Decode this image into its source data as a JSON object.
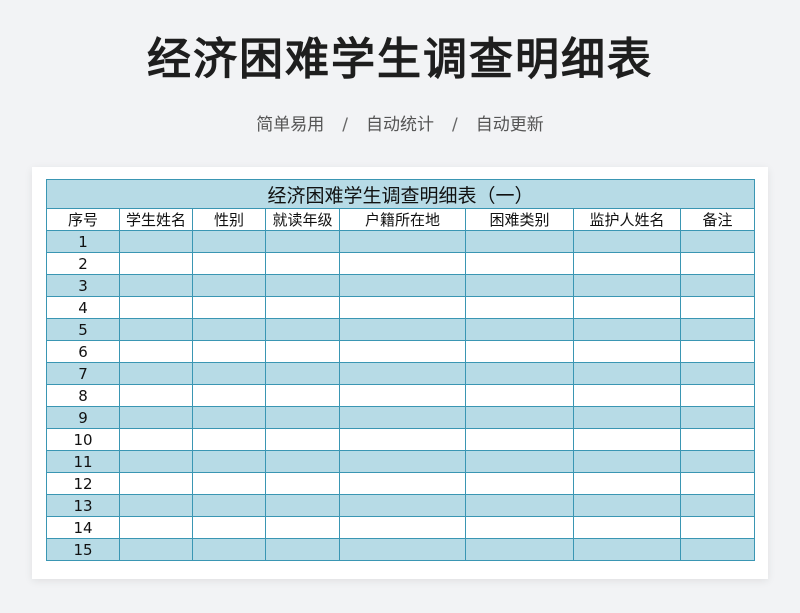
{
  "page": {
    "title": "经济困难学生调查明细表",
    "tags": [
      "简单易用",
      "自动统计",
      "自动更新"
    ],
    "separator": "/"
  },
  "table": {
    "caption": "经济困难学生调查明细表（一）",
    "columns": [
      "序号",
      "学生姓名",
      "性别",
      "就读年级",
      "户籍所在地",
      "困难类别",
      "监护人姓名",
      "备注"
    ],
    "rows": [
      {
        "no": "1"
      },
      {
        "no": "2"
      },
      {
        "no": "3"
      },
      {
        "no": "4"
      },
      {
        "no": "5"
      },
      {
        "no": "6"
      },
      {
        "no": "7"
      },
      {
        "no": "8"
      },
      {
        "no": "9"
      },
      {
        "no": "10"
      },
      {
        "no": "11"
      },
      {
        "no": "12"
      },
      {
        "no": "13"
      },
      {
        "no": "14"
      },
      {
        "no": "15"
      }
    ]
  },
  "colors": {
    "band": "#b7dbe6",
    "border": "#3a96b3",
    "background": "#f2f3f5"
  }
}
